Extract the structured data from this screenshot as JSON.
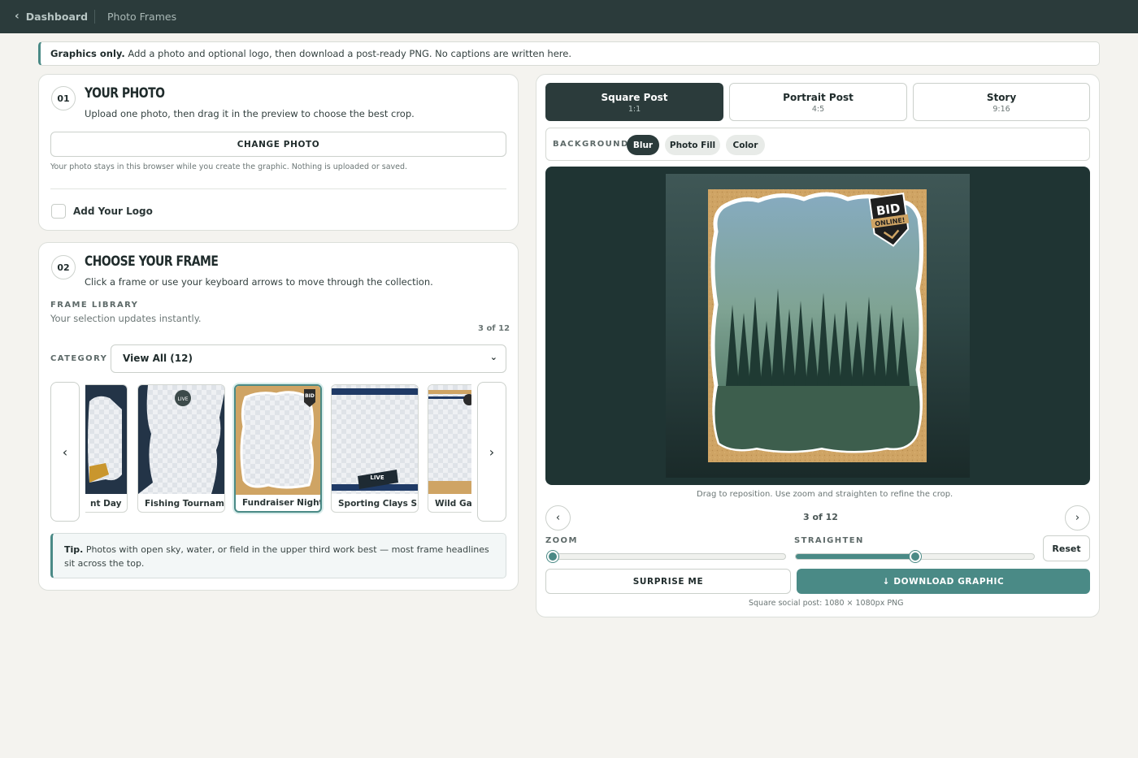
{
  "topbar": {
    "back_label": "Dashboard",
    "crumb": "Photo Frames"
  },
  "notice": {
    "bold": "Graphics only.",
    "text": " Add a photo and optional logo, then download a post-ready PNG. No captions are written here."
  },
  "step1": {
    "num": "01",
    "title": "YOUR PHOTO",
    "subtitle": "Upload one photo, then drag it in the preview to choose the best crop.",
    "change_photo": "CHANGE PHOTO",
    "privacy": "Your photo stays in this browser while you create the graphic. Nothing is uploaded or saved.",
    "logo_label": "Add Your Logo",
    "logo_checked": false
  },
  "step2": {
    "num": "02",
    "title": "CHOOSE YOUR FRAME",
    "subtitle": "Click a frame or use your keyboard arrows to move through the collection.",
    "library_label": "FRAME LIBRARY",
    "library_sub": "Your selection updates instantly.",
    "counter": "3 of 12",
    "category_label": "CATEGORY",
    "category_value": "View All (12)",
    "prev": "‹",
    "next": "›",
    "frames": [
      "nt Day",
      "Fishing Tournam…",
      "Fundraiser Night",
      "Sporting Clays S…",
      "Wild Gan"
    ],
    "selected_index": 2,
    "tip_bold": "Tip.",
    "tip_text": " Photos with open sky, water, or field in the upper third work best — most frame headlines sit across the top."
  },
  "formats": [
    {
      "name": "Square Post",
      "ratio": "1:1"
    },
    {
      "name": "Portrait Post",
      "ratio": "4:5"
    },
    {
      "name": "Story",
      "ratio": "9:16"
    }
  ],
  "active_format": 0,
  "background": {
    "label": "BACKGROUND",
    "options": [
      "Blur",
      "Photo Fill",
      "Color"
    ],
    "active": 0
  },
  "preview": {
    "badge_top": "BID",
    "badge_bottom": "ONLINE!",
    "hint": "Drag to reposition. Use zoom and straighten to refine the crop.",
    "counter": "3 of 12",
    "prev": "‹",
    "next": "›"
  },
  "controls": {
    "zoom_label": "ZOOM",
    "zoom_value": 0,
    "straighten_label": "STRAIGHTEN",
    "straighten_value": 0.5,
    "reset": "Reset",
    "surprise": "SURPRISE ME",
    "download": "↓ DOWNLOAD GRAPHIC",
    "download_note": "Square social post: 1080 × 1080px PNG"
  },
  "colors": {
    "accent": "#4a8a86",
    "dark": "#2b3b3b",
    "cork": "#cfa464"
  }
}
